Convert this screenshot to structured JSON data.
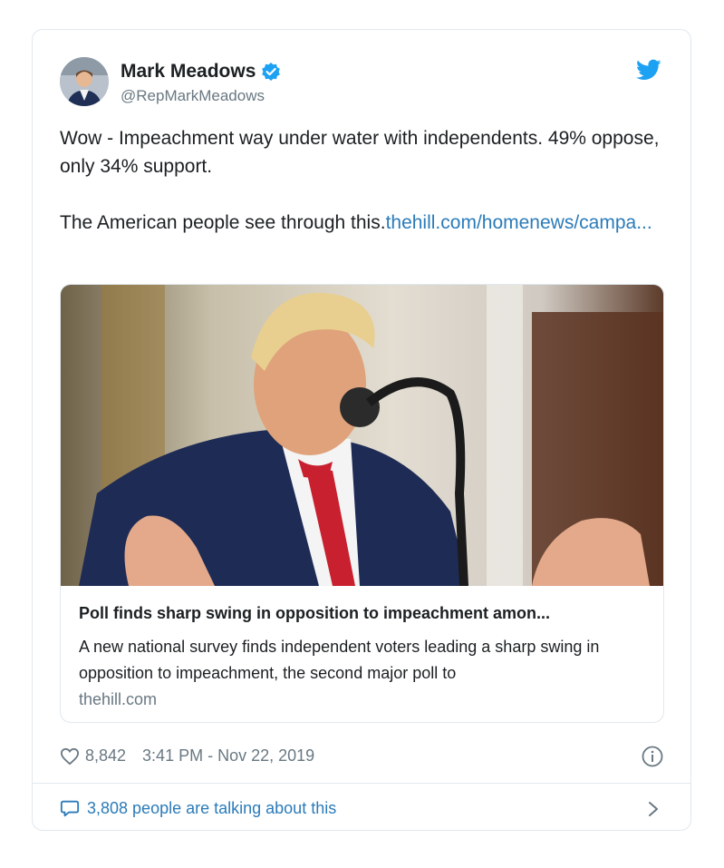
{
  "author": {
    "name": "Mark Meadows",
    "handle": "@RepMarkMeadows"
  },
  "tweet": {
    "text": "Wow - Impeachment way under water with independents. 49% oppose, only 34% support.\n\nThe American people see through this.",
    "link_text": "thehill.com/homenews/campa..."
  },
  "link_card": {
    "title": "Poll finds sharp swing in opposition to impeachment amon...",
    "description": "A new national survey finds independent voters leading a sharp swing in opposition to impeachment, the second major poll to",
    "domain": "thehill.com"
  },
  "footer": {
    "likes": "8,842",
    "timestamp": "3:41 PM - Nov 22, 2019",
    "talking": "3,808 people are talking about this"
  },
  "icons": {
    "verified": "verified-badge-icon",
    "brand": "twitter-bird-icon",
    "like": "heart-icon",
    "info": "info-icon",
    "reply": "speech-bubble-icon",
    "more": "chevron-right-icon"
  },
  "colors": {
    "link": "#2b7bb9",
    "brand": "#1da1f2",
    "muted": "#697882",
    "border": "#e1e8ed"
  }
}
